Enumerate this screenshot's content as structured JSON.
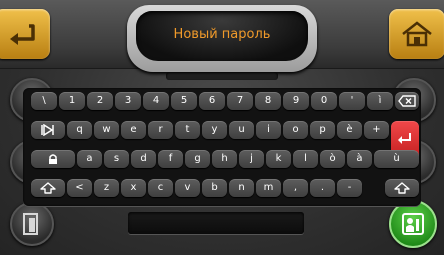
{
  "title": "Новый пароль",
  "icons": {
    "back": "back-arrow-icon",
    "home": "home-icon",
    "exit": "exit-door-icon",
    "confirm": "confirm-person-icon"
  },
  "colors": {
    "accent_orange": "#f09a2a",
    "enter_red": "#e52b2b",
    "confirm_green": "#3fb02f"
  },
  "keyboard": {
    "row1": [
      "\\",
      "1",
      "2",
      "3",
      "4",
      "5",
      "6",
      "7",
      "8",
      "9",
      "0",
      "'",
      "ì"
    ],
    "row2": [
      "q",
      "w",
      "e",
      "r",
      "t",
      "y",
      "u",
      "i",
      "o",
      "p",
      "è",
      "+"
    ],
    "row3": [
      "a",
      "s",
      "d",
      "f",
      "g",
      "h",
      "j",
      "k",
      "l",
      "ò",
      "à",
      "ù"
    ],
    "row4": [
      "<",
      "z",
      "x",
      "c",
      "v",
      "b",
      "n",
      "m",
      ",",
      ".",
      "-"
    ]
  }
}
